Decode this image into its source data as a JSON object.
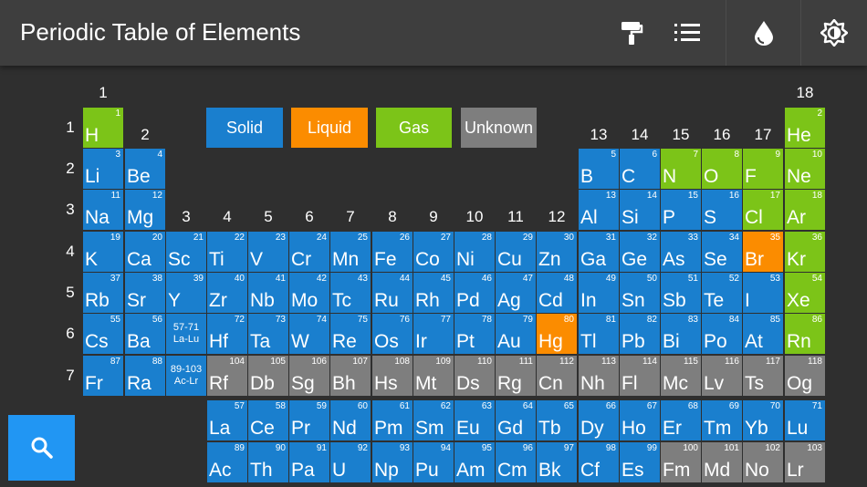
{
  "app": {
    "title": "Periodic Table of Elements",
    "toolbar": [
      {
        "icon": "paint-roller-icon"
      },
      {
        "icon": "list-icon"
      },
      {
        "icon": "water-drop-icon"
      },
      {
        "icon": "brightness-icon"
      }
    ]
  },
  "colors": {
    "solid": "#1a7fce",
    "liquid": "#fb8c00",
    "gas": "#7cc418",
    "unknown": "#7e7e7e"
  },
  "legend": [
    {
      "label": "Solid",
      "state": "solid"
    },
    {
      "label": "Liquid",
      "state": "liquid"
    },
    {
      "label": "Gas",
      "state": "gas"
    },
    {
      "label": "Unknown",
      "state": "unknown"
    }
  ],
  "group_headers": [
    "1",
    "2",
    "3",
    "4",
    "5",
    "6",
    "7",
    "8",
    "9",
    "10",
    "11",
    "12",
    "13",
    "14",
    "15",
    "16",
    "17",
    "18"
  ],
  "period_headers": [
    "1",
    "2",
    "3",
    "4",
    "5",
    "6",
    "7"
  ],
  "placeholders": [
    {
      "line1": "57-71",
      "line2": "La-Lu"
    },
    {
      "line1": "89-103",
      "line2": "Ac-Lr"
    }
  ],
  "elements": [
    {
      "z": "1",
      "s": "H",
      "state": "gas"
    },
    {
      "z": "2",
      "s": "He",
      "state": "gas"
    },
    {
      "z": "3",
      "s": "Li",
      "state": "solid"
    },
    {
      "z": "4",
      "s": "Be",
      "state": "solid"
    },
    {
      "z": "5",
      "s": "B",
      "state": "solid"
    },
    {
      "z": "6",
      "s": "C",
      "state": "solid"
    },
    {
      "z": "7",
      "s": "N",
      "state": "gas"
    },
    {
      "z": "8",
      "s": "O",
      "state": "gas"
    },
    {
      "z": "9",
      "s": "F",
      "state": "gas"
    },
    {
      "z": "10",
      "s": "Ne",
      "state": "gas"
    },
    {
      "z": "11",
      "s": "Na",
      "state": "solid"
    },
    {
      "z": "12",
      "s": "Mg",
      "state": "solid"
    },
    {
      "z": "13",
      "s": "Al",
      "state": "solid"
    },
    {
      "z": "14",
      "s": "Si",
      "state": "solid"
    },
    {
      "z": "15",
      "s": "P",
      "state": "solid"
    },
    {
      "z": "16",
      "s": "S",
      "state": "solid"
    },
    {
      "z": "17",
      "s": "Cl",
      "state": "gas"
    },
    {
      "z": "18",
      "s": "Ar",
      "state": "gas"
    },
    {
      "z": "19",
      "s": "K",
      "state": "solid"
    },
    {
      "z": "20",
      "s": "Ca",
      "state": "solid"
    },
    {
      "z": "21",
      "s": "Sc",
      "state": "solid"
    },
    {
      "z": "22",
      "s": "Ti",
      "state": "solid"
    },
    {
      "z": "23",
      "s": "V",
      "state": "solid"
    },
    {
      "z": "24",
      "s": "Cr",
      "state": "solid"
    },
    {
      "z": "25",
      "s": "Mn",
      "state": "solid"
    },
    {
      "z": "26",
      "s": "Fe",
      "state": "solid"
    },
    {
      "z": "27",
      "s": "Co",
      "state": "solid"
    },
    {
      "z": "28",
      "s": "Ni",
      "state": "solid"
    },
    {
      "z": "29",
      "s": "Cu",
      "state": "solid"
    },
    {
      "z": "30",
      "s": "Zn",
      "state": "solid"
    },
    {
      "z": "31",
      "s": "Ga",
      "state": "solid"
    },
    {
      "z": "32",
      "s": "Ge",
      "state": "solid"
    },
    {
      "z": "33",
      "s": "As",
      "state": "solid"
    },
    {
      "z": "34",
      "s": "Se",
      "state": "solid"
    },
    {
      "z": "35",
      "s": "Br",
      "state": "liquid"
    },
    {
      "z": "36",
      "s": "Kr",
      "state": "gas"
    },
    {
      "z": "37",
      "s": "Rb",
      "state": "solid"
    },
    {
      "z": "38",
      "s": "Sr",
      "state": "solid"
    },
    {
      "z": "39",
      "s": "Y",
      "state": "solid"
    },
    {
      "z": "40",
      "s": "Zr",
      "state": "solid"
    },
    {
      "z": "41",
      "s": "Nb",
      "state": "solid"
    },
    {
      "z": "42",
      "s": "Mo",
      "state": "solid"
    },
    {
      "z": "43",
      "s": "Tc",
      "state": "solid"
    },
    {
      "z": "44",
      "s": "Ru",
      "state": "solid"
    },
    {
      "z": "45",
      "s": "Rh",
      "state": "solid"
    },
    {
      "z": "46",
      "s": "Pd",
      "state": "solid"
    },
    {
      "z": "47",
      "s": "Ag",
      "state": "solid"
    },
    {
      "z": "48",
      "s": "Cd",
      "state": "solid"
    },
    {
      "z": "49",
      "s": "In",
      "state": "solid"
    },
    {
      "z": "50",
      "s": "Sn",
      "state": "solid"
    },
    {
      "z": "51",
      "s": "Sb",
      "state": "solid"
    },
    {
      "z": "52",
      "s": "Te",
      "state": "solid"
    },
    {
      "z": "53",
      "s": "I",
      "state": "solid"
    },
    {
      "z": "54",
      "s": "Xe",
      "state": "gas"
    },
    {
      "z": "55",
      "s": "Cs",
      "state": "solid"
    },
    {
      "z": "56",
      "s": "Ba",
      "state": "solid"
    },
    {
      "z": "72",
      "s": "Hf",
      "state": "solid"
    },
    {
      "z": "73",
      "s": "Ta",
      "state": "solid"
    },
    {
      "z": "74",
      "s": "W",
      "state": "solid"
    },
    {
      "z": "75",
      "s": "Re",
      "state": "solid"
    },
    {
      "z": "76",
      "s": "Os",
      "state": "solid"
    },
    {
      "z": "77",
      "s": "Ir",
      "state": "solid"
    },
    {
      "z": "78",
      "s": "Pt",
      "state": "solid"
    },
    {
      "z": "79",
      "s": "Au",
      "state": "solid"
    },
    {
      "z": "80",
      "s": "Hg",
      "state": "liquid"
    },
    {
      "z": "81",
      "s": "Tl",
      "state": "solid"
    },
    {
      "z": "82",
      "s": "Pb",
      "state": "solid"
    },
    {
      "z": "83",
      "s": "Bi",
      "state": "solid"
    },
    {
      "z": "84",
      "s": "Po",
      "state": "solid"
    },
    {
      "z": "85",
      "s": "At",
      "state": "solid"
    },
    {
      "z": "86",
      "s": "Rn",
      "state": "gas"
    },
    {
      "z": "87",
      "s": "Fr",
      "state": "solid"
    },
    {
      "z": "88",
      "s": "Ra",
      "state": "solid"
    },
    {
      "z": "104",
      "s": "Rf",
      "state": "unknown"
    },
    {
      "z": "105",
      "s": "Db",
      "state": "unknown"
    },
    {
      "z": "106",
      "s": "Sg",
      "state": "unknown"
    },
    {
      "z": "107",
      "s": "Bh",
      "state": "unknown"
    },
    {
      "z": "108",
      "s": "Hs",
      "state": "unknown"
    },
    {
      "z": "109",
      "s": "Mt",
      "state": "unknown"
    },
    {
      "z": "110",
      "s": "Ds",
      "state": "unknown"
    },
    {
      "z": "111",
      "s": "Rg",
      "state": "unknown"
    },
    {
      "z": "112",
      "s": "Cn",
      "state": "unknown"
    },
    {
      "z": "113",
      "s": "Nh",
      "state": "unknown"
    },
    {
      "z": "114",
      "s": "Fl",
      "state": "unknown"
    },
    {
      "z": "115",
      "s": "Mc",
      "state": "unknown"
    },
    {
      "z": "116",
      "s": "Lv",
      "state": "unknown"
    },
    {
      "z": "117",
      "s": "Ts",
      "state": "unknown"
    },
    {
      "z": "118",
      "s": "Og",
      "state": "unknown"
    },
    {
      "z": "57",
      "s": "La",
      "state": "solid"
    },
    {
      "z": "58",
      "s": "Ce",
      "state": "solid"
    },
    {
      "z": "59",
      "s": "Pr",
      "state": "solid"
    },
    {
      "z": "60",
      "s": "Nd",
      "state": "solid"
    },
    {
      "z": "61",
      "s": "Pm",
      "state": "solid"
    },
    {
      "z": "62",
      "s": "Sm",
      "state": "solid"
    },
    {
      "z": "63",
      "s": "Eu",
      "state": "solid"
    },
    {
      "z": "64",
      "s": "Gd",
      "state": "solid"
    },
    {
      "z": "65",
      "s": "Tb",
      "state": "solid"
    },
    {
      "z": "66",
      "s": "Dy",
      "state": "solid"
    },
    {
      "z": "67",
      "s": "Ho",
      "state": "solid"
    },
    {
      "z": "68",
      "s": "Er",
      "state": "solid"
    },
    {
      "z": "69",
      "s": "Tm",
      "state": "solid"
    },
    {
      "z": "70",
      "s": "Yb",
      "state": "solid"
    },
    {
      "z": "71",
      "s": "Lu",
      "state": "solid"
    },
    {
      "z": "89",
      "s": "Ac",
      "state": "solid"
    },
    {
      "z": "90",
      "s": "Th",
      "state": "solid"
    },
    {
      "z": "91",
      "s": "Pa",
      "state": "solid"
    },
    {
      "z": "92",
      "s": "U",
      "state": "solid"
    },
    {
      "z": "93",
      "s": "Np",
      "state": "solid"
    },
    {
      "z": "94",
      "s": "Pu",
      "state": "solid"
    },
    {
      "z": "95",
      "s": "Am",
      "state": "solid"
    },
    {
      "z": "96",
      "s": "Cm",
      "state": "solid"
    },
    {
      "z": "97",
      "s": "Bk",
      "state": "solid"
    },
    {
      "z": "98",
      "s": "Cf",
      "state": "solid"
    },
    {
      "z": "99",
      "s": "Es",
      "state": "solid"
    },
    {
      "z": "100",
      "s": "Fm",
      "state": "unknown"
    },
    {
      "z": "101",
      "s": "Md",
      "state": "unknown"
    },
    {
      "z": "102",
      "s": "No",
      "state": "unknown"
    },
    {
      "z": "103",
      "s": "Lr",
      "state": "unknown"
    }
  ],
  "search": {
    "icon": "search-icon"
  }
}
